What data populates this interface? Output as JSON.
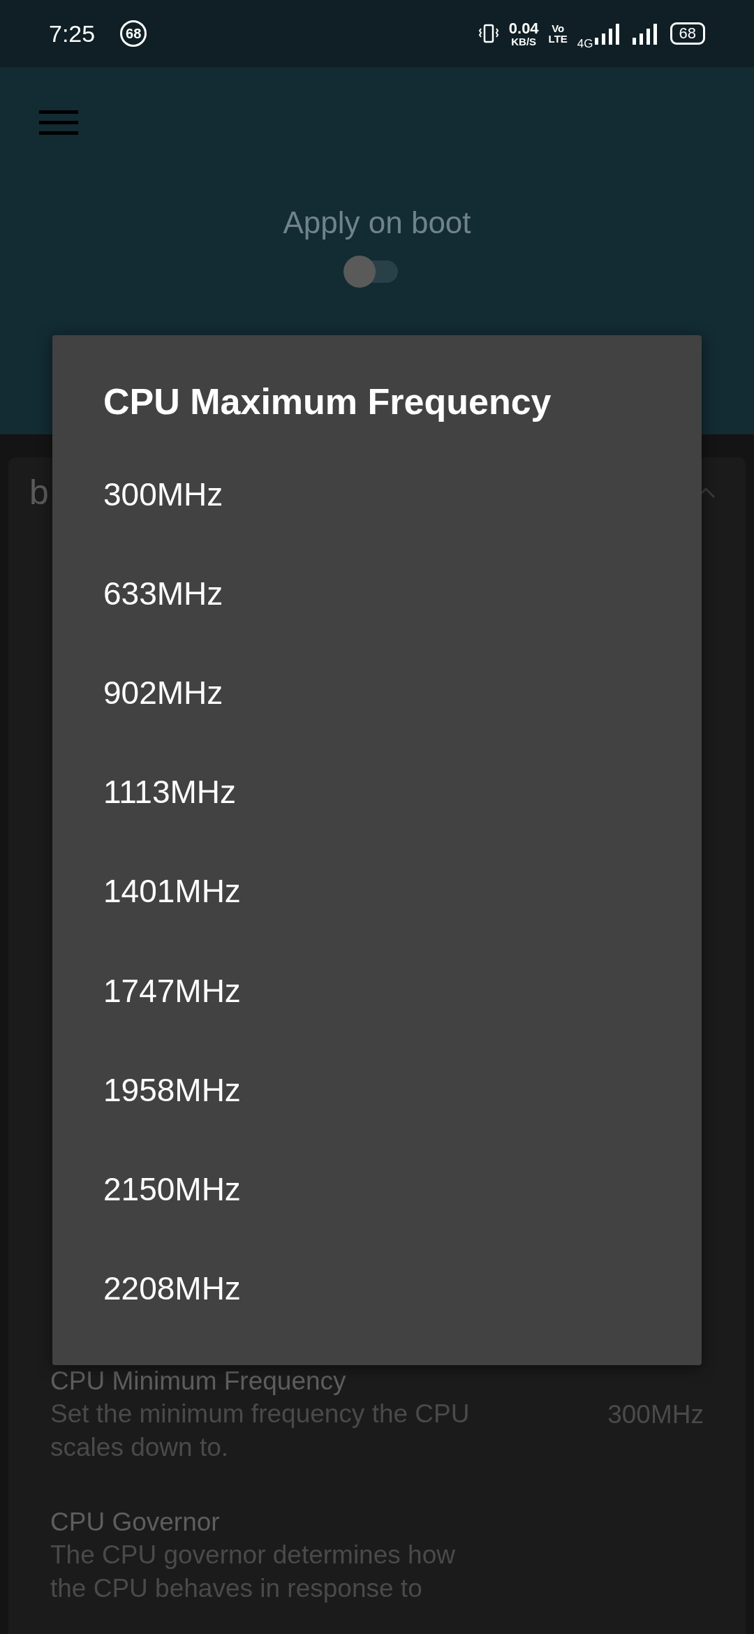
{
  "status_bar": {
    "time": "7:25",
    "notification_badge": "68",
    "net_speed": "0.04",
    "net_unit": "KB/S",
    "volte_top": "Vo",
    "volte_bottom": "LTE",
    "network_type": "4G",
    "battery": "68"
  },
  "header": {
    "apply_on_boot": {
      "label": "Apply on boot",
      "on": false
    }
  },
  "card": {
    "title": "b",
    "expanded": true,
    "settings": [
      {
        "title": "CPU Minimum Frequency",
        "description": "Set the minimum frequency the CPU scales down to.",
        "value": "300MHz"
      },
      {
        "title": "CPU Governor",
        "description": "The CPU governor determines how the CPU behaves in response to"
      }
    ]
  },
  "dialog": {
    "title": "CPU Maximum Frequency",
    "options": [
      "300MHz",
      "633MHz",
      "902MHz",
      "1113MHz",
      "1401MHz",
      "1747MHz",
      "1958MHz",
      "2150MHz",
      "2208MHz"
    ]
  }
}
